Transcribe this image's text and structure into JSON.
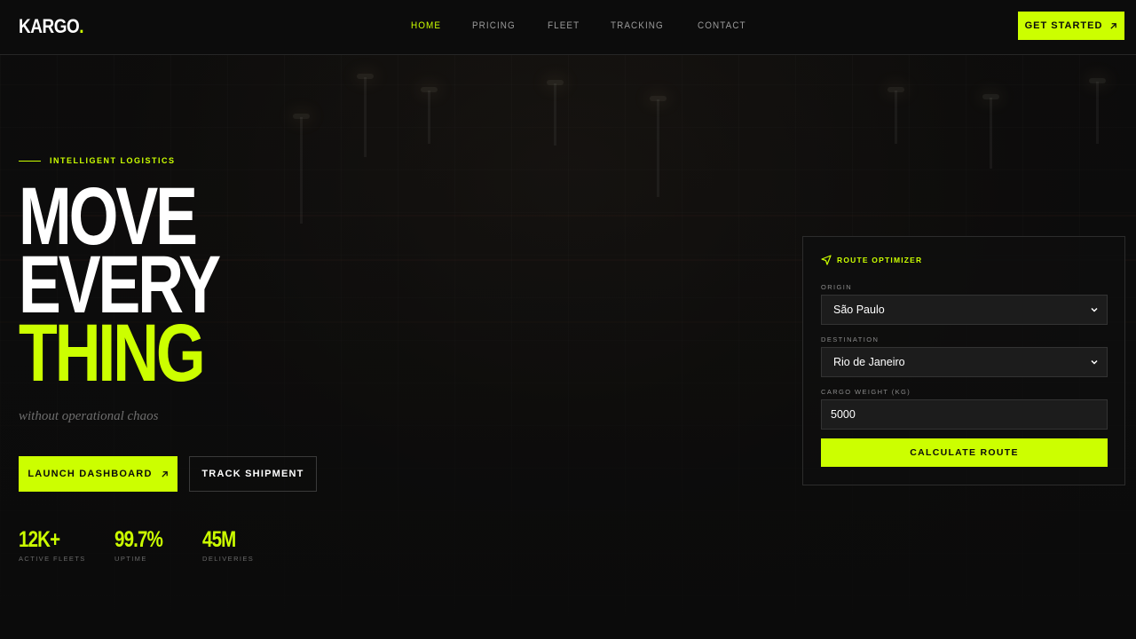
{
  "brand": {
    "name": "KARGO",
    "dot": ".",
    "accent": "#ccff00"
  },
  "nav": [
    {
      "label": "HOME",
      "active": true
    },
    {
      "label": "PRICING",
      "active": false
    },
    {
      "label": "FLEET",
      "active": false
    },
    {
      "label": "TRACKING",
      "active": false
    },
    {
      "label": "CONTACT",
      "active": false
    }
  ],
  "header": {
    "cta_label": "GET STARTED",
    "cta_icon": "arrow-up-right-icon"
  },
  "hero": {
    "eyebrow": "INTELLIGENT LOGISTICS",
    "headline": [
      "MOVE",
      "EVERY",
      "THING"
    ],
    "tagline": "without operational chaos",
    "primary_button": "LAUNCH DASHBOARD",
    "secondary_button": "TRACK SHIPMENT"
  },
  "stats": [
    {
      "value": "12K+",
      "label": "ACTIVE FLEETS"
    },
    {
      "value": "99.7%",
      "label": "UPTIME"
    },
    {
      "value": "45M",
      "label": "DELIVERIES"
    }
  ],
  "route_optimizer": {
    "title": "ROUTE OPTIMIZER",
    "title_icon": "navigation-arrow-icon",
    "origin_label": "ORIGIN",
    "origin_value": "São Paulo",
    "destination_label": "DESTINATION",
    "destination_value": "Rio de Janeiro",
    "weight_label": "CARGO WEIGHT (KG)",
    "weight_value": "5000",
    "submit_label": "CALCULATE ROUTE"
  }
}
